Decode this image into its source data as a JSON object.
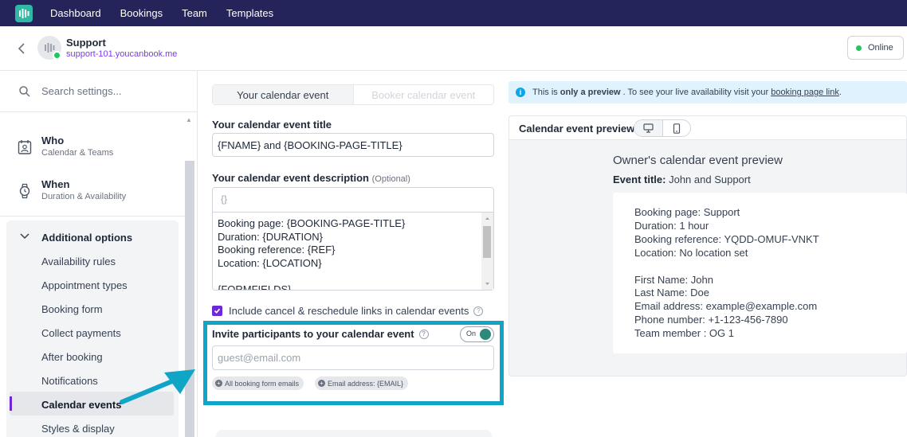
{
  "topnav": {
    "items": [
      "Dashboard",
      "Bookings",
      "Team",
      "Templates"
    ]
  },
  "header": {
    "title": "Support",
    "link": "support-101.youcanbook.me",
    "status": "Online"
  },
  "sidebar": {
    "search_placeholder": "Search settings...",
    "sections": [
      {
        "title": "Who",
        "subtitle": "Calendar & Teams"
      },
      {
        "title": "When",
        "subtitle": "Duration & Availability"
      }
    ],
    "group_title": "Additional options",
    "items": [
      "Availability rules",
      "Appointment types",
      "Booking form",
      "Collect payments",
      "After booking",
      "Notifications",
      "Calendar events",
      "Styles & display"
    ],
    "active_item": "Calendar events"
  },
  "form": {
    "tabs": [
      "Your calendar event",
      "Booker calendar event"
    ],
    "title_label": "Your calendar event title",
    "title_value": "{FNAME} and {BOOKING-PAGE-TITLE}",
    "description_label": "Your calendar event description",
    "description_optional": "(Optional)",
    "description_toolbar": "{}",
    "description_value": "Booking page: {BOOKING-PAGE-TITLE}\nDuration: {DURATION}\nBooking reference: {REF}\nLocation: {LOCATION}\n\n{FORMFIELDS}",
    "checkbox_label": "Include cancel & reschedule links in calendar events",
    "invite_label": "Invite participants to your calendar event",
    "toggle_label": "On",
    "guest_placeholder": "guest@email.com",
    "chips": [
      "All booking form emails",
      "Email address: {EMAIL}"
    ]
  },
  "preview": {
    "info_prefix": "This is",
    "info_bold": "only a preview",
    "info_middle": ". To see your live availability visit your",
    "info_link": "booking page link",
    "info_suffix": ".",
    "panel_title": "Calendar event preview",
    "owner_title": "Owner's calendar event preview",
    "event_title_label": "Event title:",
    "event_title_value": "John and Support",
    "event_body": "Booking page: Support\nDuration: 1 hour\nBooking reference: YQDD-OMUF-VNKT\nLocation: No location set\n\nFirst Name: John\nLast Name: Doe\nEmail address: example@example.com\nPhone number: +1-123-456-7890\nTeam member : OG 1"
  },
  "colors": {
    "nav_bg": "#24235a",
    "accent": "#6d28d9",
    "highlight": "#0ea5c6",
    "toggle_on": "#2d8a7a",
    "online": "#22c55e"
  }
}
